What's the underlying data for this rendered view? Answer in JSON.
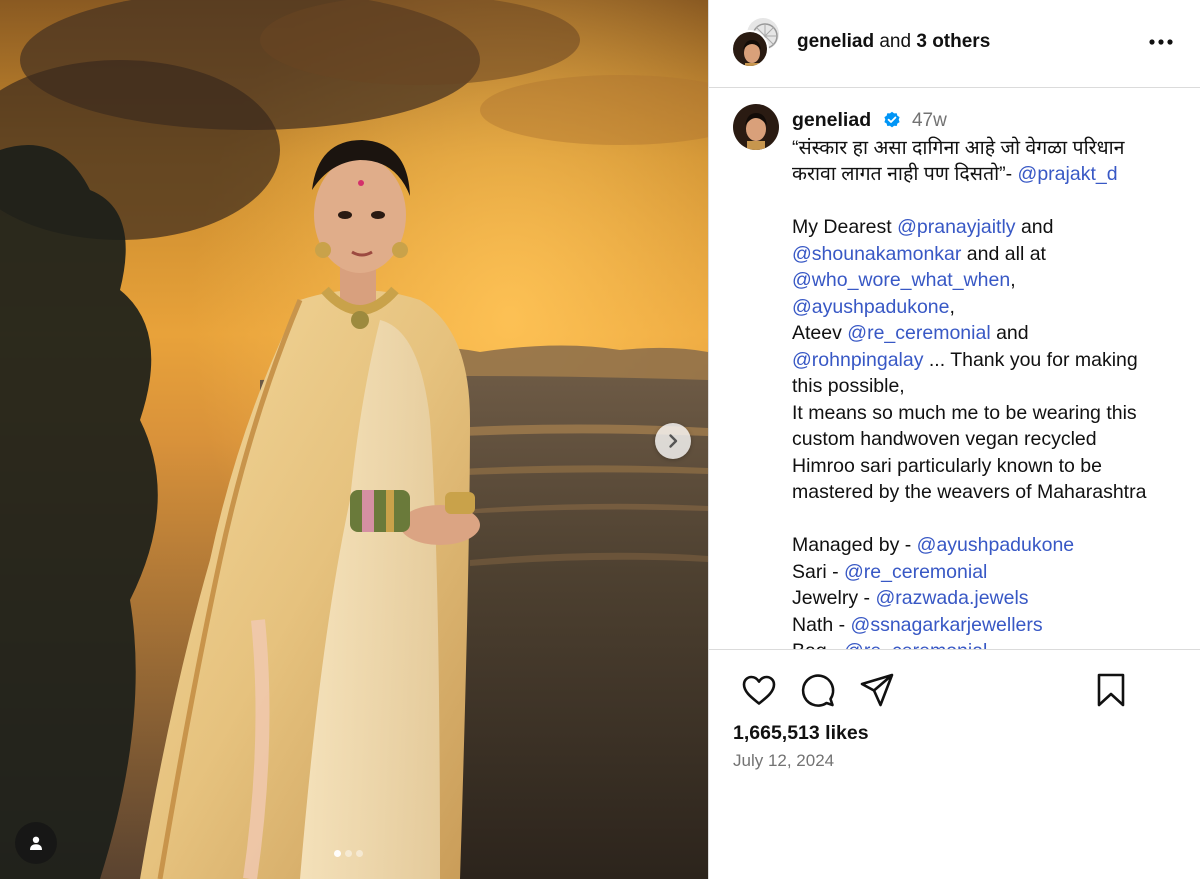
{
  "header": {
    "username": "geneliad",
    "others_text": "and",
    "others_count": "3 others",
    "more_icon": "more-horizontal-icon"
  },
  "caption": {
    "username": "geneliad",
    "time": "47w",
    "lines": [
      [
        {
          "t": "“संस्कार हा असा दागिना आहे जो वेगळा परिधान"
        }
      ],
      [
        {
          "t": "करावा लागत नाही पण दिसतो”- "
        },
        {
          "t": "@prajakt_d",
          "m": true
        }
      ],
      [],
      [
        {
          "t": "My Dearest "
        },
        {
          "t": "@pranayjaitly",
          "m": true
        },
        {
          "t": " and"
        }
      ],
      [
        {
          "t": "@shounakamonkar",
          "m": true
        },
        {
          "t": " and all at"
        }
      ],
      [
        {
          "t": "@who_wore_what_when",
          "m": true
        },
        {
          "t": ","
        }
      ],
      [
        {
          "t": "@ayushpadukone",
          "m": true
        },
        {
          "t": ","
        }
      ],
      [
        {
          "t": "Ateev "
        },
        {
          "t": "@re_ceremonial",
          "m": true
        },
        {
          "t": " and"
        }
      ],
      [
        {
          "t": "@rohnpingalay",
          "m": true
        },
        {
          "t": " ... Thank you for making"
        }
      ],
      [
        {
          "t": "this possible,"
        }
      ],
      [
        {
          "t": "It means so much me to be wearing this"
        }
      ],
      [
        {
          "t": "custom handwoven vegan recycled"
        }
      ],
      [
        {
          "t": "Himroo sari particularly known to be"
        }
      ],
      [
        {
          "t": "mastered by the weavers of Maharashtra"
        }
      ],
      [],
      [
        {
          "t": "Managed by - "
        },
        {
          "t": "@ayushpadukone",
          "m": true
        }
      ],
      [
        {
          "t": "Sari - "
        },
        {
          "t": "@re_ceremonial",
          "m": true
        }
      ],
      [
        {
          "t": "Jewelry - "
        },
        {
          "t": "@razwada.jewels",
          "m": true
        }
      ],
      [
        {
          "t": "Nath - "
        },
        {
          "t": "@ssnagarkarjewellers",
          "m": true
        }
      ],
      [
        {
          "t": "Bag - "
        },
        {
          "t": "@re_ceremonial",
          "m": true
        }
      ]
    ]
  },
  "actions": {
    "likes": "1,665,513 likes",
    "date": "July 12, 2024",
    "icons": [
      "heart-icon",
      "comment-icon",
      "share-icon",
      "bookmark-icon"
    ]
  },
  "media": {
    "carousel_count": 3,
    "carousel_active": 1,
    "next_icon": "chevron-right-icon",
    "tag_icon": "user-tag-icon"
  },
  "colors": {
    "mention": "#3858c5",
    "verified": "#0095f6",
    "muted": "#737373",
    "divider": "#dbdbdb"
  }
}
